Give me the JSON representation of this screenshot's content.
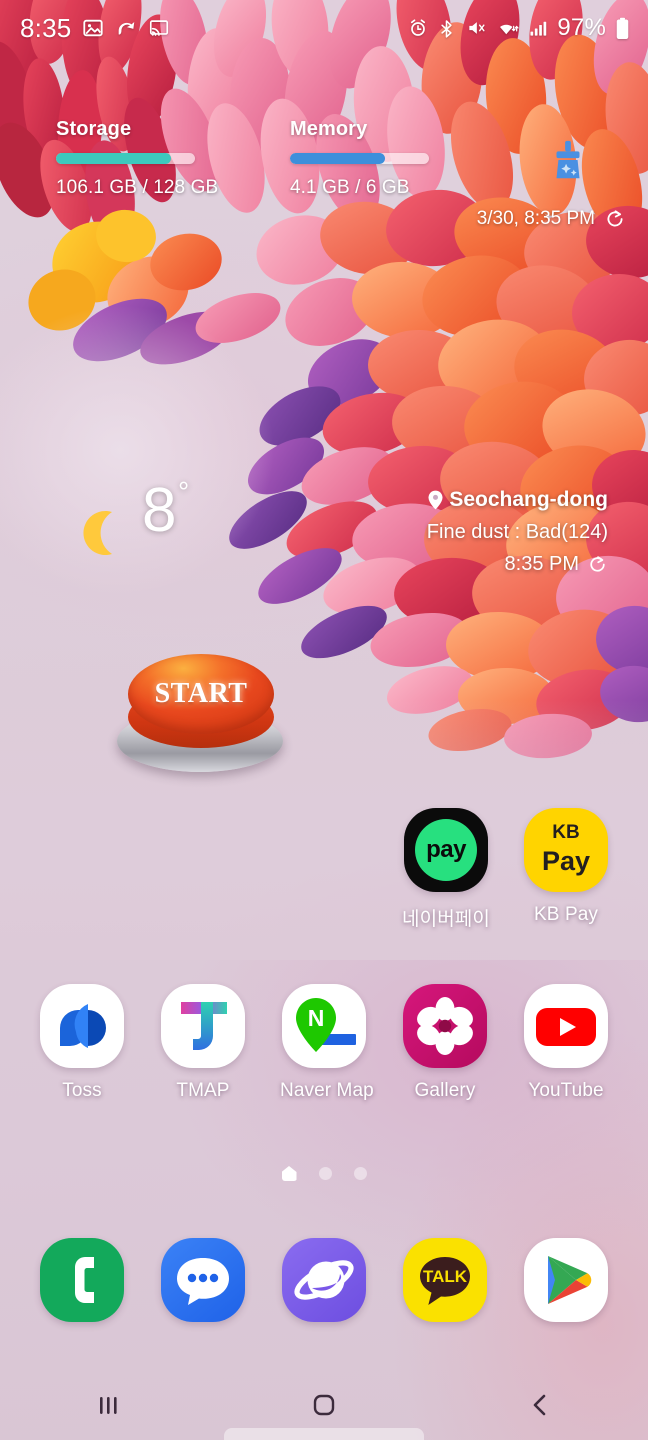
{
  "status_bar": {
    "time": "8:35",
    "battery_percent": "97%",
    "left_icons": [
      "image-icon",
      "swirl-icon",
      "screen-cast-icon"
    ],
    "right_icons": [
      "alarm-icon",
      "bluetooth-icon",
      "mute-icon",
      "wifi-icon",
      "signal-icon",
      "battery-icon"
    ]
  },
  "system_monitor": {
    "storage": {
      "title": "Storage",
      "value": "106.1 GB / 128 GB",
      "percent": 83,
      "color": "#3dc9bd"
    },
    "memory": {
      "title": "Memory",
      "value": "4.1 GB / 6 GB",
      "percent": 68,
      "color": "#3d8fdb"
    },
    "clean_icon": "broom-icon",
    "updated": "3/30, 8:35 PM",
    "refresh_icon": "refresh-icon"
  },
  "weather": {
    "condition_icon": "moon-icon",
    "temperature": "8",
    "degree": "°",
    "location": "Seochang-dong",
    "location_icon": "location-pin-icon",
    "fine_dust": "Fine dust : Bad(124)",
    "updated": "8:35 PM",
    "refresh_icon": "refresh-icon"
  },
  "start_widget": {
    "label": "START"
  },
  "pay_row": [
    {
      "label": "네이버페이",
      "icon": "naverpay-icon",
      "icon_text": "pay"
    },
    {
      "label": "KB Pay",
      "icon": "kbpay-icon",
      "icon_text_1": "KB",
      "icon_text_2": "Pay"
    }
  ],
  "app_row": [
    {
      "label": "Toss",
      "icon": "toss-icon"
    },
    {
      "label": "TMAP",
      "icon": "tmap-icon",
      "icon_text": "T"
    },
    {
      "label": "Naver Map",
      "icon": "naver-map-icon",
      "icon_text": "N"
    },
    {
      "label": "Gallery",
      "icon": "gallery-icon"
    },
    {
      "label": "YouTube",
      "icon": "youtube-icon"
    }
  ],
  "page_indicator": {
    "count": 3,
    "active_index": 0
  },
  "dock": [
    {
      "label": "Phone",
      "icon": "phone-icon"
    },
    {
      "label": "Messages",
      "icon": "messages-icon"
    },
    {
      "label": "Samsung Internet",
      "icon": "internet-icon"
    },
    {
      "label": "KakaoTalk",
      "icon": "kakaotalk-icon",
      "icon_text": "TALK"
    },
    {
      "label": "Play Store",
      "icon": "play-store-icon"
    }
  ],
  "nav_bar": {
    "recents": "recents-icon",
    "home": "home-icon",
    "back": "back-icon"
  },
  "colors": {
    "wallpaper_base": "#ddcbd8",
    "accent_storage": "#3dc9bd",
    "accent_memory": "#3d8fdb",
    "start_button": "#e8481e",
    "label_text": "#ffffff"
  }
}
